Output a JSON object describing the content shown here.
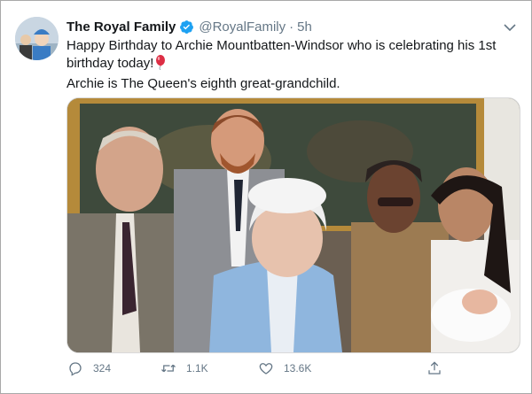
{
  "tweet": {
    "author_name": "The Royal Family",
    "author_handle": "@RoyalFamily",
    "separator": "·",
    "timestamp": "5h",
    "text_line1": "Happy Birthday to Archie Mountbatten-Windsor who is celebrating his 1st birthday today!",
    "balloon_icon": "balloon-emoji",
    "text_line2": "Archie is The Queen's eighth great-grandchild.",
    "verified_icon": "verified-badge-icon",
    "verified_color": "#1da1f2"
  },
  "actions": {
    "reply_count": "324",
    "retweet_count": "1.1K",
    "like_count": "13.6K",
    "reply_icon": "reply-icon",
    "retweet_icon": "retweet-icon",
    "like_icon": "heart-icon",
    "share_icon": "share-icon"
  },
  "colors": {
    "text": "#14171a",
    "secondary": "#657786",
    "accent": "#1da1f2"
  }
}
